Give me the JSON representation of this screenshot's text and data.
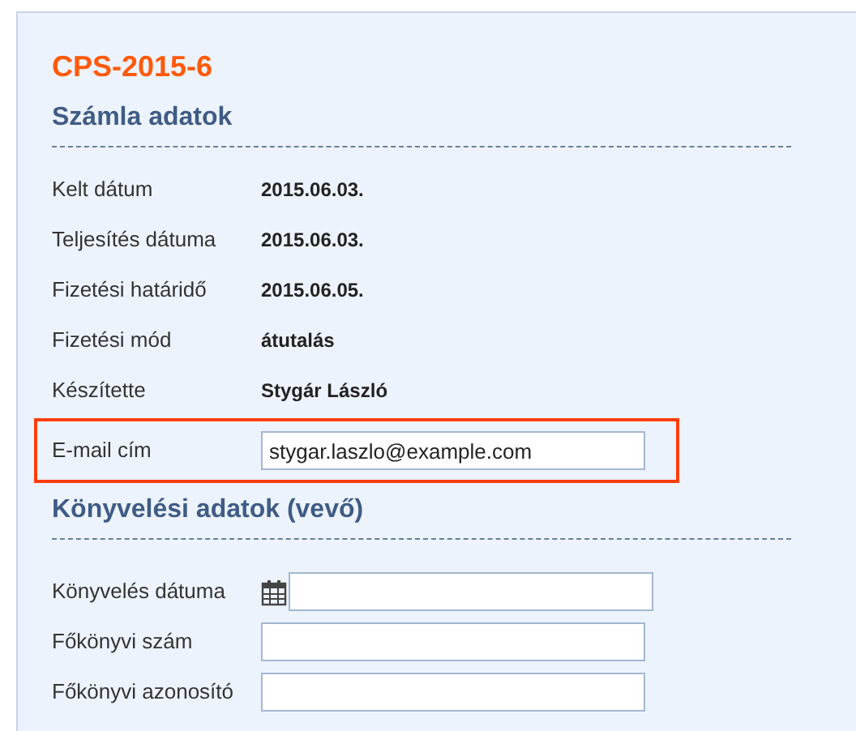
{
  "title": "CPS-2015-6",
  "sections": [
    {
      "heading": "Számla adatok",
      "rows": [
        {
          "kind": "value",
          "label": "Kelt dátum",
          "value": "2015.06.03."
        },
        {
          "kind": "value",
          "label": "Teljesítés dátuma",
          "value": "2015.06.03."
        },
        {
          "kind": "value",
          "label": "Fizetési határidő",
          "value": "2015.06.05."
        },
        {
          "kind": "value",
          "label": "Fizetési mód",
          "value": "átutalás"
        },
        {
          "kind": "value",
          "label": "Készítette",
          "value": "Stygár László"
        },
        {
          "kind": "text",
          "label": "E-mail cím",
          "value": "stygar.laszlo@example.com",
          "highlighted": true
        }
      ]
    },
    {
      "heading": "Könyvelési adatok (vevő)",
      "rows": [
        {
          "kind": "date",
          "label": "Könyvelés dátuma",
          "highlighted": false
        },
        {
          "kind": "text",
          "label": "Főkönyvi szám",
          "highlighted": false
        },
        {
          "kind": "text",
          "label": "Főkönyvi azonosító",
          "highlighted": false
        }
      ]
    }
  ]
}
